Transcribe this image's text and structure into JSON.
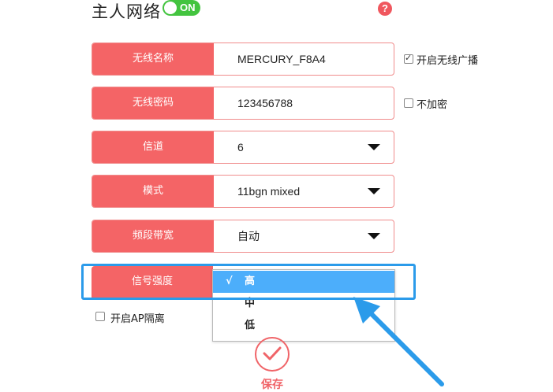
{
  "header": {
    "title": "主人网络",
    "toggle_label": "ON",
    "help_icon": "question-icon"
  },
  "form": {
    "ssid": {
      "label": "无线名称",
      "value": "MERCURY_F8A4",
      "broadcast_label": "开启无线广播",
      "broadcast_checked": true
    },
    "password": {
      "label": "无线密码",
      "value": "123456788",
      "no_encrypt_label": "不加密",
      "no_encrypt_checked": false
    },
    "channel": {
      "label": "信道",
      "value": "6"
    },
    "mode": {
      "label": "模式",
      "value": "11bgn mixed"
    },
    "bandwidth": {
      "label": "频段带宽",
      "value": "自动"
    },
    "signal": {
      "label": "信号强度",
      "options": [
        "高",
        "中",
        "低"
      ],
      "selected_mark": "√"
    },
    "ap_isolation": {
      "label": "开启AP隔离",
      "checked": false
    }
  },
  "footer": {
    "save_label": "保存"
  },
  "colors": {
    "accent": "#f46466",
    "toggle": "#43c43f",
    "highlight": "#2b9bea",
    "selected_option": "#4caefb"
  }
}
